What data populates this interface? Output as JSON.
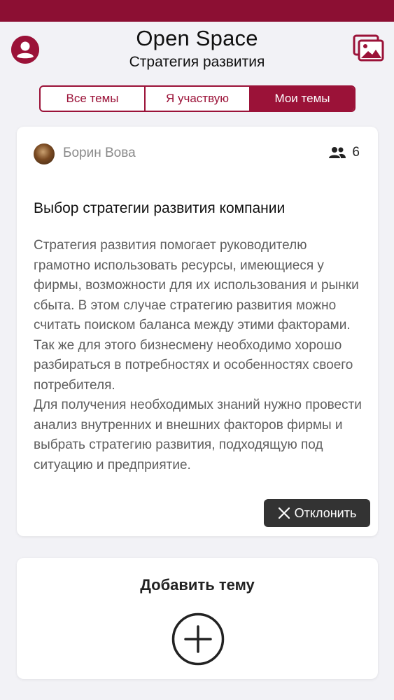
{
  "header": {
    "title": "Open Space",
    "subtitle": "Стратегия развития",
    "profile_icon": "user-circle-icon",
    "gallery_icon": "images-icon"
  },
  "tabs": [
    {
      "label": "Все темы",
      "active": false
    },
    {
      "label": "Я участвую",
      "active": false
    },
    {
      "label": "Мои темы",
      "active": true
    }
  ],
  "topic": {
    "author": "Борин Вова",
    "participants_count": "6",
    "title": "Выбор стратегии развития компании",
    "body": "Стратегия развития помогает руководителю грамотно использовать ресурсы, имеющиеся у фирмы, возможности для их использования и рынки сбыта. В этом случае стратегию развития можно считать поиском баланса между этими факторами. Так же для этого бизнесмену необходимо хорошо разбираться в потребностях и особенностях своего потребителя.\nДля получения необходимых знаний нужно провести анализ внутренних и внешних факторов фирмы и выбрать стратегию развития, подходящую под ситуацию и предприятие.",
    "decline_label": "Отклонить"
  },
  "add_topic": {
    "label": "Добавить тему"
  },
  "colors": {
    "brand": "#9b1238",
    "topbar": "#8c0f33",
    "background": "#f2f2f6",
    "dark_button": "#333333"
  }
}
